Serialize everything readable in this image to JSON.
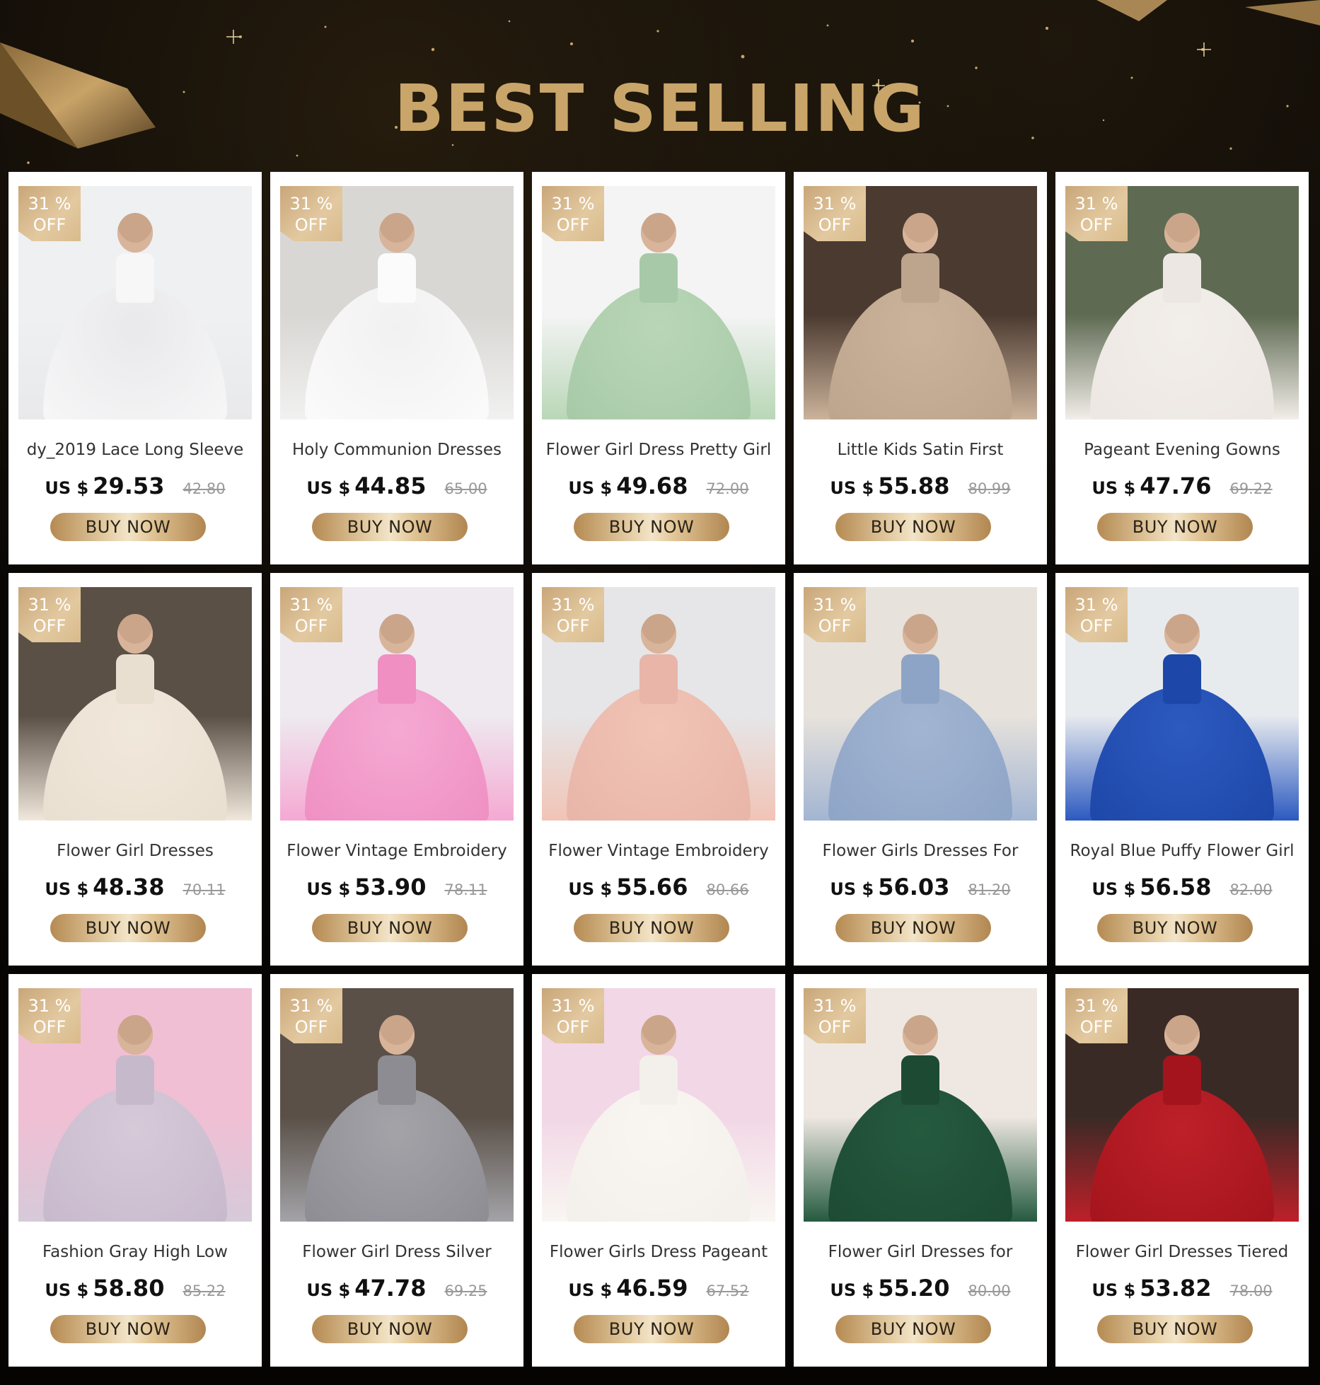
{
  "header": {
    "title": "BEST SELLING"
  },
  "colors": {
    "gold": "#c9a56a",
    "background": "#070502",
    "card": "#ffffff"
  },
  "products": [
    {
      "name": "dy_2019 Lace Long Sleeve",
      "discount_value": "31 %",
      "discount_label": "OFF",
      "currency": "US $",
      "price": "29.53",
      "original_price": "42.80",
      "button": "BUY NOW",
      "image": "white-ball-gown-with-bow"
    },
    {
      "name": "Holy Communion Dresses",
      "discount_value": "31 %",
      "discount_label": "OFF",
      "currency": "US $",
      "price": "44.85",
      "original_price": "65.00",
      "button": "BUY NOW",
      "image": "white-tulle-dresses-with-petals"
    },
    {
      "name": "Flower Girl Dress Pretty Girl",
      "discount_value": "31 %",
      "discount_label": "OFF",
      "currency": "US $",
      "price": "49.68",
      "original_price": "72.00",
      "button": "BUY NOW",
      "image": "mint-green-high-low-dress"
    },
    {
      "name": "Little Kids Satin First",
      "discount_value": "31 %",
      "discount_label": "OFF",
      "currency": "US $",
      "price": "55.88",
      "original_price": "80.99",
      "button": "BUY NOW",
      "image": "champagne-satin-gown"
    },
    {
      "name": "Pageant Evening Gowns",
      "discount_value": "31 %",
      "discount_label": "OFF",
      "currency": "US $",
      "price": "47.76",
      "original_price": "69.22",
      "button": "BUY NOW",
      "image": "ivory-butterfly-ball-gown"
    },
    {
      "name": "Flower Girl Dresses",
      "discount_value": "31 %",
      "discount_label": "OFF",
      "currency": "US $",
      "price": "48.38",
      "original_price": "70.11",
      "button": "BUY NOW",
      "image": "champagne-lace-ball-gown"
    },
    {
      "name": "Flower Vintage Embroidery",
      "discount_value": "31 %",
      "discount_label": "OFF",
      "currency": "US $",
      "price": "53.90",
      "original_price": "78.11",
      "button": "BUY NOW",
      "image": "pink-tulle-ball-gown"
    },
    {
      "name": "Flower Vintage Embroidery",
      "discount_value": "31 %",
      "discount_label": "OFF",
      "currency": "US $",
      "price": "55.66",
      "original_price": "80.66",
      "button": "BUY NOW",
      "image": "blush-pink-satin-dress"
    },
    {
      "name": "Flower Girls Dresses For",
      "discount_value": "31 %",
      "discount_label": "OFF",
      "currency": "US $",
      "price": "56.03",
      "original_price": "81.20",
      "button": "BUY NOW",
      "image": "dusty-blue-tulle-gown"
    },
    {
      "name": "Royal Blue Puffy Flower Girl",
      "discount_value": "31 %",
      "discount_label": "OFF",
      "currency": "US $",
      "price": "56.58",
      "original_price": "82.00",
      "button": "BUY NOW",
      "image": "royal-blue-ruffle-gown"
    },
    {
      "name": "Fashion Gray High Low",
      "discount_value": "31 %",
      "discount_label": "OFF",
      "currency": "US $",
      "price": "58.80",
      "original_price": "85.22",
      "button": "BUY NOW",
      "image": "lavender-gray-high-low-dress"
    },
    {
      "name": "Flower Girl Dress Silver",
      "discount_value": "31 %",
      "discount_label": "OFF",
      "currency": "US $",
      "price": "47.78",
      "original_price": "69.25",
      "button": "BUY NOW",
      "image": "silver-sequin-ball-gown"
    },
    {
      "name": "Flower Girls Dress Pageant",
      "discount_value": "31 %",
      "discount_label": "OFF",
      "currency": "US $",
      "price": "46.59",
      "original_price": "67.52",
      "button": "BUY NOW",
      "image": "white-lace-train-gown"
    },
    {
      "name": "Flower Girl Dresses for",
      "discount_value": "31 %",
      "discount_label": "OFF",
      "currency": "US $",
      "price": "55.20",
      "original_price": "80.00",
      "button": "BUY NOW",
      "image": "emerald-green-lace-gown"
    },
    {
      "name": "Flower Girl Dresses Tiered",
      "discount_value": "31 %",
      "discount_label": "OFF",
      "currency": "US $",
      "price": "53.82",
      "original_price": "78.00",
      "button": "BUY NOW",
      "image": "red-sequin-tiered-gown"
    }
  ]
}
